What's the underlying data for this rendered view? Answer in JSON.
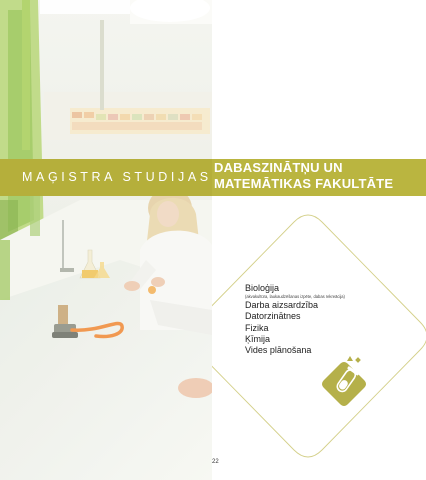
{
  "header": {
    "subtitle": "MAĢISTRA STUDIJAS",
    "title_line1": "DABASZINĀTŅU UN",
    "title_line2": "MATEMĀTIKAS FAKULTĀTE"
  },
  "programs": [
    {
      "label": "Bioloģija",
      "note": "(akvakultūra, laukaudzēšanas izpēte, dabas rekreācija)"
    },
    {
      "label": "Darba aizsardzība"
    },
    {
      "label": "Datorzinātnes"
    },
    {
      "label": "Fizika"
    },
    {
      "label": "Ķīmija"
    },
    {
      "label": "Vides plānošana"
    }
  ],
  "page_number": "22",
  "colors": {
    "accent": "#bab540",
    "diamond_stroke": "#d4d08a",
    "badge_fill": "#b5b04a"
  },
  "icons": {
    "badge": "test-tube-icon",
    "photo": "laboratory-photo"
  }
}
